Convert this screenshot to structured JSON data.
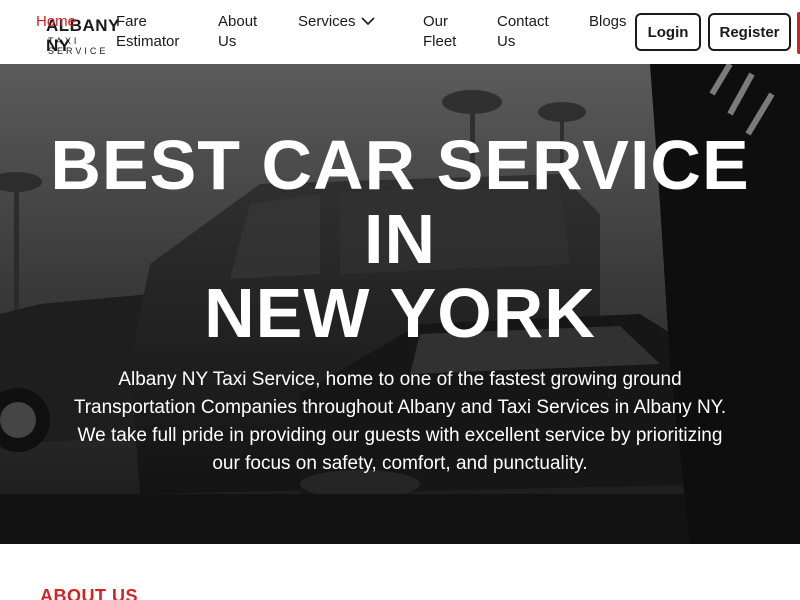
{
  "header": {
    "logo": {
      "main": "ALBANY NY",
      "sub": "TAXI SERVICE"
    },
    "nav": {
      "home": "Home",
      "fare_estimator": "Fare Estimator",
      "about_us": "About Us",
      "services": "Services",
      "our_fleet": "Our Fleet",
      "contact_us": "Contact Us",
      "blogs": "Blogs"
    },
    "login_label": "Login",
    "register_label": "Register"
  },
  "hero": {
    "title_lines": [
      "BEST CAR SERVICE",
      "IN",
      "NEW YORK"
    ],
    "description": "Albany NY Taxi Service, home to one of the fastest growing ground Transportation Companies throughout Albany and Taxi Services in Albany NY. We take full pride in providing our guests with excellent service by prioritizing our focus on safety, comfort, and punctuality."
  },
  "about": {
    "heading": "ABOUT US"
  },
  "colors": {
    "accent": "#d42222",
    "text": "#1a1a1a",
    "hero_overlay": "#2b2b2b"
  }
}
